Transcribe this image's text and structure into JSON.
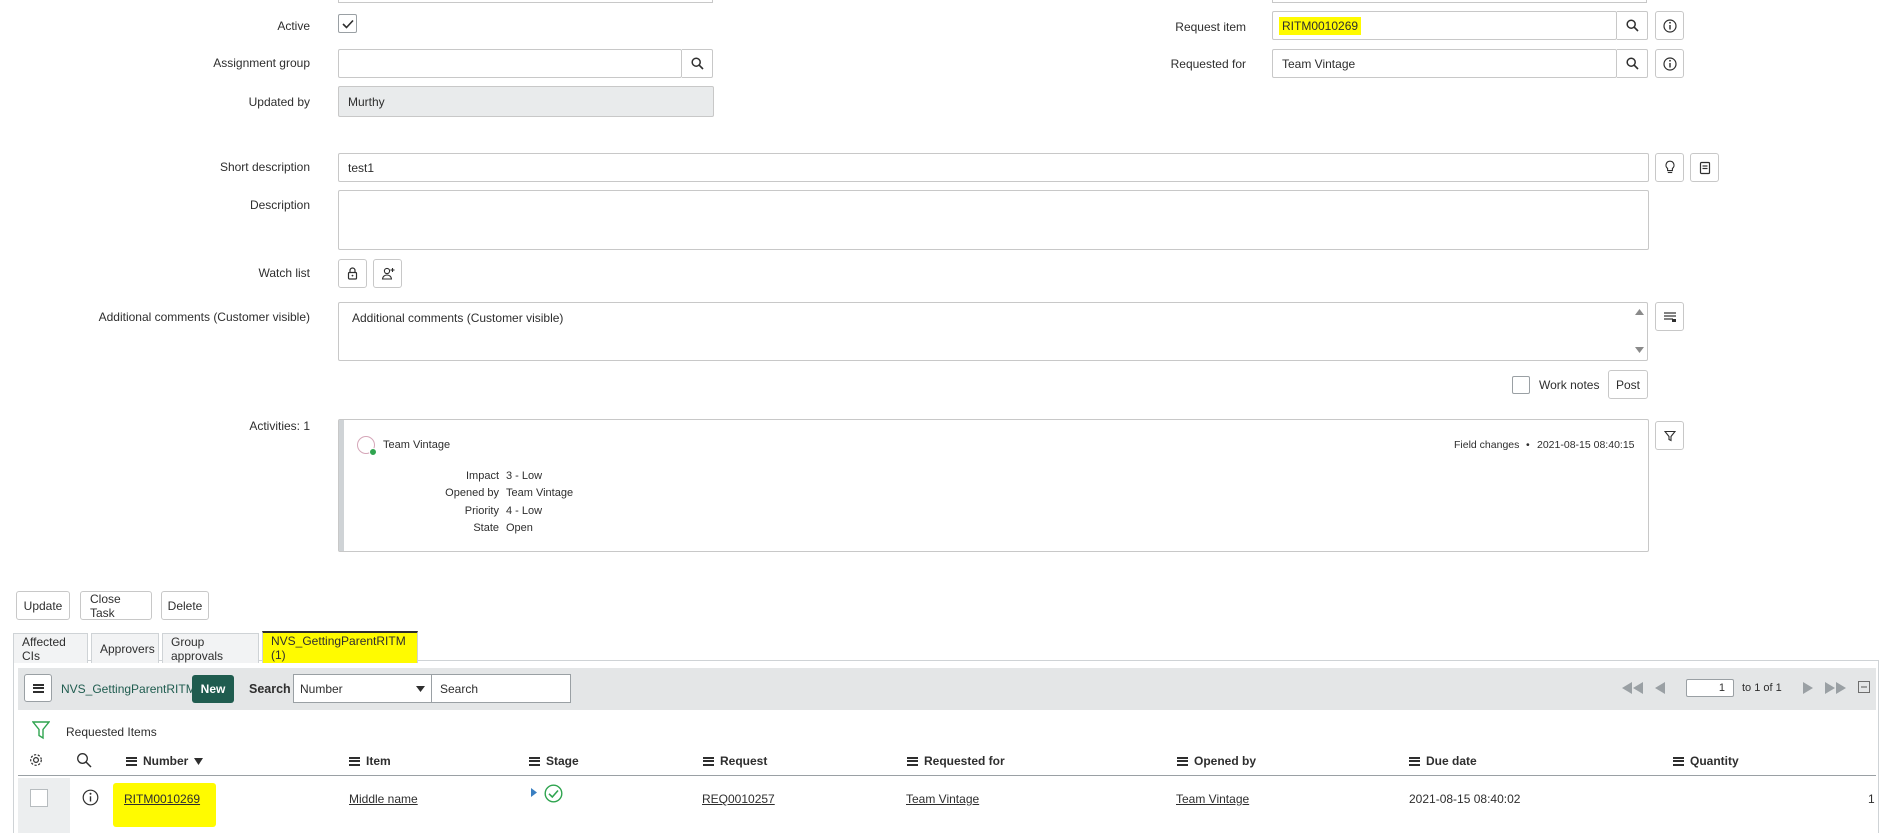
{
  "form": {
    "active_label": "Active",
    "assignment_group_label": "Assignment group",
    "assignment_group_value": "",
    "updated_by_label": "Updated by",
    "updated_by_value": "Murthy",
    "request_item_label": "Request item",
    "request_item_value": "RITM0010269",
    "requested_for_label": "Requested for",
    "requested_for_value": "Team Vintage",
    "short_description_label": "Short description",
    "short_description_value": "test1",
    "description_label": "Description",
    "watch_list_label": "Watch list",
    "additional_comments_label": "Additional comments (Customer visible)",
    "additional_comments_placeholder": "Additional comments (Customer visible)",
    "work_notes_label": "Work notes",
    "post_label": "Post",
    "activities_label": "Activities: 1"
  },
  "activity": {
    "author": "Team Vintage",
    "type": "Field changes",
    "bullet": "•",
    "timestamp": "2021-08-15 08:40:15",
    "changes": [
      {
        "field": "Impact",
        "value": "3 - Low"
      },
      {
        "field": "Opened by",
        "value": "Team Vintage"
      },
      {
        "field": "Priority",
        "value": "4 - Low"
      },
      {
        "field": "State",
        "value": "Open"
      }
    ]
  },
  "actions": {
    "update": "Update",
    "close_task": "Close Task",
    "delete": "Delete"
  },
  "tabs": [
    {
      "label": "Affected CIs"
    },
    {
      "label": "Approvers"
    },
    {
      "label": "Group approvals"
    },
    {
      "label": "NVS_GettingParentRITM (1)"
    }
  ],
  "list": {
    "title": "NVS_GettingParentRITM",
    "new_label": "New",
    "search_label": "Search",
    "search_field": "Number",
    "search_placeholder": "Search",
    "page_value": "1",
    "page_total": "to 1 of 1",
    "breadcrumb": "Requested Items",
    "columns": [
      {
        "label": "Number",
        "sorted": true
      },
      {
        "label": "Item"
      },
      {
        "label": "Stage"
      },
      {
        "label": "Request"
      },
      {
        "label": "Requested for"
      },
      {
        "label": "Opened by"
      },
      {
        "label": "Due date"
      },
      {
        "label": "Quantity"
      }
    ],
    "rows": [
      {
        "number": "RITM0010269",
        "item": "Middle name",
        "request": "REQ0010257",
        "requested_for": "Team Vintage",
        "opened_by": "Team Vintage",
        "due_date": "2021-08-15 08:40:02",
        "quantity": "1"
      }
    ]
  },
  "colors": {
    "highlight": "#fffb00",
    "new_button": "#1f5c4f",
    "list_title": "#1f5c4f",
    "stage_complete": "#2fa44f"
  }
}
